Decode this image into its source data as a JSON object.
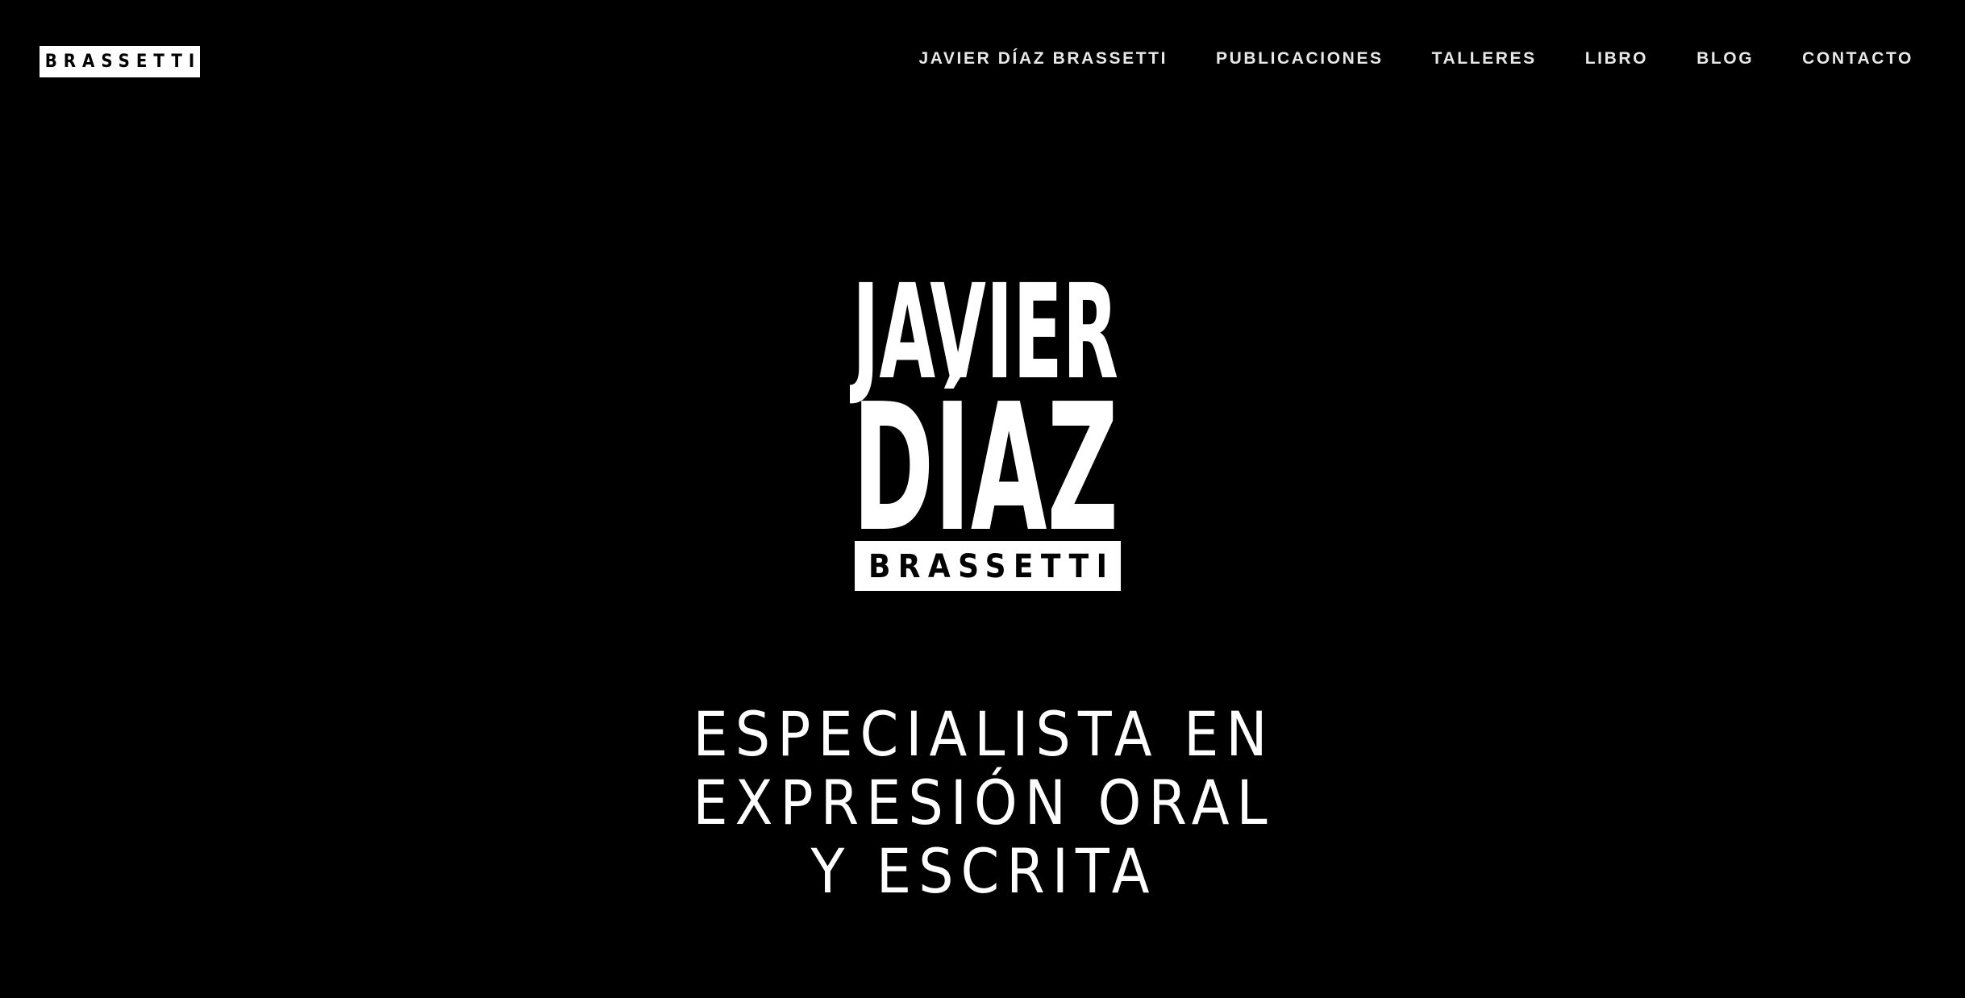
{
  "header": {
    "logo_text": "BRASSETTI",
    "nav": [
      {
        "label": "JAVIER DÍAZ BRASSETTI"
      },
      {
        "label": "PUBLICACIONES"
      },
      {
        "label": "TALLERES"
      },
      {
        "label": "LIBRO"
      },
      {
        "label": "BLOG"
      },
      {
        "label": "CONTACTO"
      }
    ]
  },
  "hero": {
    "logo_line1": "JAVIER",
    "logo_line2": "DÍAZ",
    "logo_line3": "BRASSETTI",
    "tagline": [
      "ESPECIALISTA EN",
      "EXPRESIÓN ORAL",
      "Y ESCRITA"
    ]
  },
  "colors": {
    "background": "#000000",
    "foreground": "#ffffff"
  }
}
